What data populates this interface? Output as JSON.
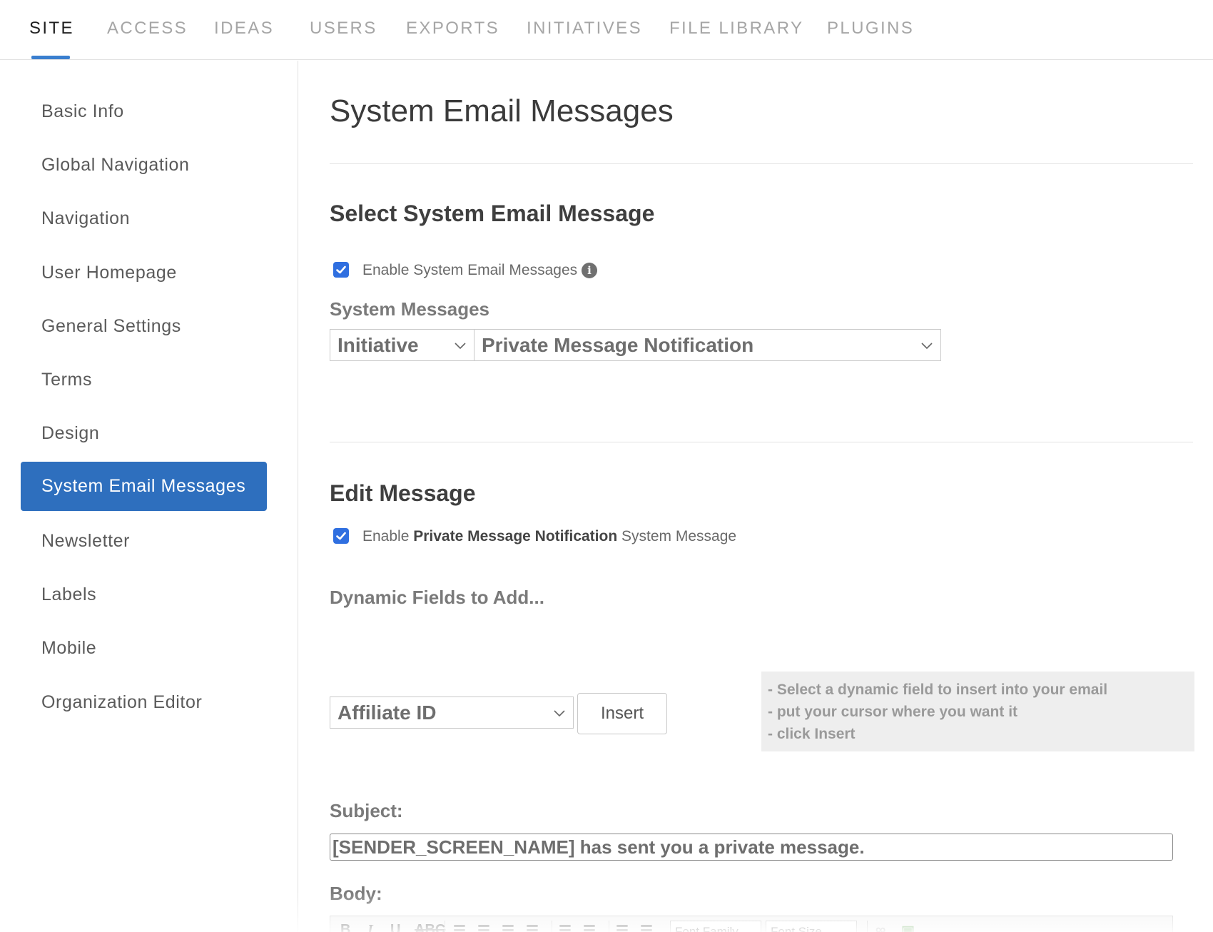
{
  "top_tabs": [
    {
      "label": "SITE",
      "active": true
    },
    {
      "label": "ACCESS"
    },
    {
      "label": "IDEAS"
    },
    {
      "label": "USERS"
    },
    {
      "label": "EXPORTS"
    },
    {
      "label": "INITIATIVES"
    },
    {
      "label": "FILE LIBRARY"
    },
    {
      "label": "PLUGINS"
    }
  ],
  "sidebar": {
    "items": [
      {
        "label": "Basic Info"
      },
      {
        "label": "Global Navigation"
      },
      {
        "label": "Navigation"
      },
      {
        "label": "User Homepage"
      },
      {
        "label": "General Settings"
      },
      {
        "label": "Terms"
      },
      {
        "label": "Design"
      },
      {
        "label": "System Email Messages",
        "active": true
      },
      {
        "label": "Newsletter"
      },
      {
        "label": "Labels"
      },
      {
        "label": "Mobile"
      },
      {
        "label": "Organization Editor"
      }
    ]
  },
  "main": {
    "title": "System Email Messages",
    "select_section": {
      "title": "Select System Email Message",
      "enable_label": "Enable System Email Messages",
      "enable_checked": true,
      "messages_label": "System Messages",
      "category_value": "Initiative",
      "message_value": "Private Message Notification"
    },
    "edit_section": {
      "title": "Edit Message",
      "enable_prefix": "Enable",
      "enable_name": "Private Message Notification",
      "enable_suffix": "System Message",
      "enable_checked": true,
      "dynamic_label": "Dynamic Fields to Add...",
      "dynamic_value": "Affiliate ID",
      "insert_label": "Insert",
      "hint_lines": [
        "- Select a dynamic field to insert into your email",
        "- put your cursor where you want it",
        "- click Insert"
      ],
      "subject_label": "Subject:",
      "subject_value": "[SENDER_SCREEN_NAME] has sent you a private message.",
      "body_label": "Body:",
      "toolbar": {
        "bold": "B",
        "italic": "I",
        "underline": "U",
        "font_family": "Font Family",
        "font_size": "Font Size"
      }
    }
  },
  "colors": {
    "accent": "#2e6fbe",
    "tab_underline": "#3a7fcf",
    "checkbox": "#2f6fe0"
  }
}
